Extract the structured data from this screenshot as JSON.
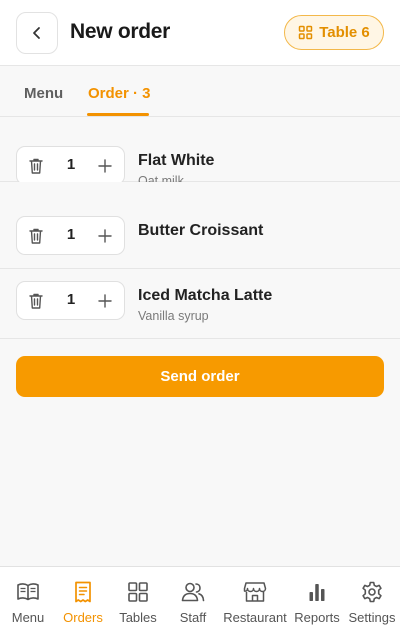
{
  "header": {
    "title": "New order",
    "table_chip": "Table 6",
    "back_icon": "chevron-left-icon"
  },
  "tabs": [
    {
      "label": "Menu",
      "active": false
    },
    {
      "label": "Order · 3",
      "active": true
    }
  ],
  "order_items": [
    {
      "quantity": "1",
      "name": "Flat White",
      "note": "Oat milk"
    },
    {
      "quantity": "1",
      "name": "Butter Croissant",
      "note": ""
    },
    {
      "quantity": "1",
      "name": "Iced Matcha Latte",
      "note": "Vanilla syrup"
    }
  ],
  "send_label": "Send order",
  "nav": [
    {
      "label": "Menu",
      "icon": "book-icon",
      "active": false
    },
    {
      "label": "Orders",
      "icon": "receipt-icon",
      "active": true
    },
    {
      "label": "Tables",
      "icon": "grid-icon",
      "active": false
    },
    {
      "label": "Staff",
      "icon": "people-icon",
      "active": false
    },
    {
      "label": "Restaurant",
      "icon": "storefront-icon",
      "active": false
    },
    {
      "label": "Reports",
      "icon": "bar-chart-icon",
      "active": false
    },
    {
      "label": "Settings",
      "icon": "gear-icon",
      "active": false
    }
  ],
  "colors": {
    "accent": "#f39200",
    "button": "#f79a00",
    "chip_bg": "#fff6e5",
    "chip_border": "#f3b84a",
    "background": "#f8f8f8"
  }
}
